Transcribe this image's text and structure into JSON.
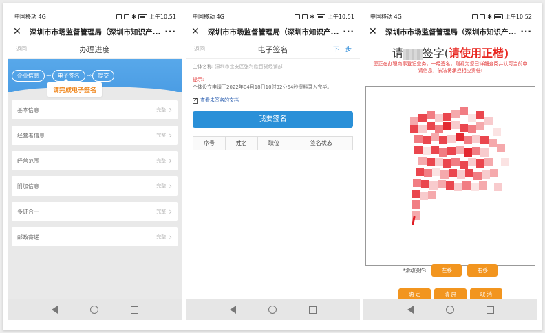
{
  "status": {
    "carrier": "中国移动",
    "signal": "4G",
    "time1": "上午10:51",
    "time2": "上午10:51",
    "time3": "上午10:52"
  },
  "app": {
    "title": "深圳市市场监督管理局（深圳市知识产...",
    "more": "···",
    "close": "✕"
  },
  "screen1": {
    "back": "返回",
    "title": "办理进度",
    "steps": [
      "企业信息",
      "电子签名",
      "提交"
    ],
    "tooltip": "请完成电子签名",
    "rows": [
      {
        "label": "基本信息",
        "status": "完整"
      },
      {
        "label": "经营者信息",
        "status": "完整"
      },
      {
        "label": "经营范围",
        "status": "完整"
      },
      {
        "label": "附加信息",
        "status": "完整"
      },
      {
        "label": "多证合一",
        "status": "完整"
      },
      {
        "label": "邮政寄递",
        "status": "完整"
      }
    ]
  },
  "screen2": {
    "back": "返回",
    "title": "电子签名",
    "next": "下一步",
    "subject_label": "主体名称:",
    "subject_value": "深圳市宝安区张利欣百货经销部",
    "tip_title": "提示:",
    "tip_body": "个体设立申请于2022年04月18日10时32分64秒资料录入完毕。",
    "checkbox_label": "查看未签名的文档",
    "sign_button": "我要签名",
    "table_headers": [
      "序号",
      "姓名",
      "职位",
      "签名状态"
    ]
  },
  "screen3": {
    "title_prefix": "请",
    "title_mid": "签字(",
    "title_red": "请使用正楷",
    "title_suffix": ")",
    "warning": "您正在办理商事登记业务，一经签名，则视为您已详细查阅并认可当前申请信息，依法将承担相应责任!",
    "scroll_label": "*滑动操作:",
    "left_btn": "左移",
    "right_btn": "右移",
    "confirm": "确 定",
    "clear": "清 屏",
    "cancel": "取 消"
  },
  "colors": {
    "accent_blue": "#2a90d8",
    "orange": "#f2951f",
    "red": "#e8261f"
  }
}
